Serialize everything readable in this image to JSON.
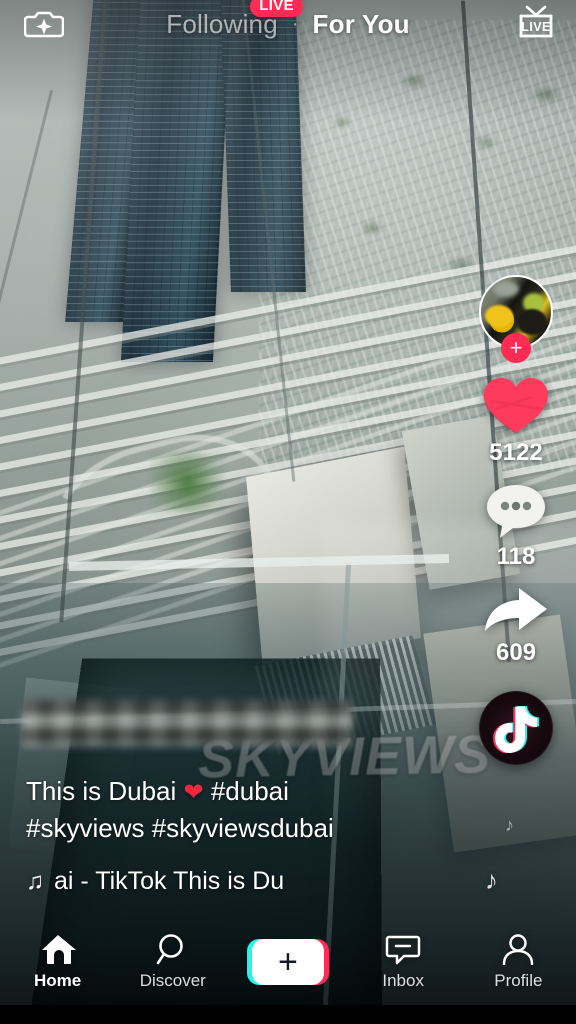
{
  "app": {
    "name": "TikTok",
    "screen": "For You feed"
  },
  "top_bar": {
    "effects_icon": "camera-sparkle-icon",
    "tabs": [
      {
        "label": "Following",
        "active": false
      },
      {
        "label": "For You",
        "active": true
      }
    ],
    "separator": "·",
    "live_badge": "LIVE",
    "live_button_label": "LIVE",
    "live_button_icon": "live-tv-icon"
  },
  "rail": {
    "avatar_name": "creator-avatar",
    "follow_label": "+",
    "actions": [
      {
        "name": "like",
        "icon": "heart-icon",
        "count": "5122"
      },
      {
        "name": "comment",
        "icon": "comment-icon",
        "count": "118"
      },
      {
        "name": "share",
        "icon": "share-arrow-icon",
        "count": "609"
      }
    ],
    "disc_icon": "tiktok-logo-disc"
  },
  "caption": {
    "line1_a": "This is Dubai ",
    "heart": "❤",
    "line1_b": " #dubai",
    "line2": "#skyviews #skyviewsdubai",
    "music_note": "♫",
    "music_text": "ai - TikTok    This is Du"
  },
  "video": {
    "watermark": "SKYVIEWS",
    "description": "Aerial view of Dubai through a glass floor"
  },
  "bottom_nav": {
    "items": [
      {
        "label": "Home",
        "icon": "home-icon",
        "active": true
      },
      {
        "label": "Discover",
        "icon": "search-icon",
        "active": false
      },
      {
        "label": "Inbox",
        "icon": "inbox-icon",
        "active": false
      },
      {
        "label": "Profile",
        "icon": "person-icon",
        "active": false
      }
    ],
    "create_label": "+"
  },
  "colors": {
    "accent_pink": "#FE2C55",
    "accent_cyan": "#25F4EE",
    "heart_red": "#FE2C55",
    "text_white": "#FFFFFF"
  }
}
